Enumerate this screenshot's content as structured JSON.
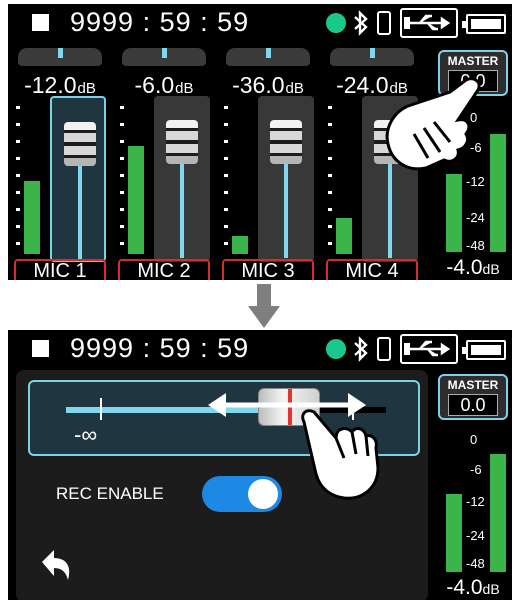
{
  "status": {
    "timecode": "9999 : 59 : 59",
    "icons": [
      "stop-icon",
      "record-status-icon",
      "bluetooth-icon",
      "phone-icon",
      "usb-icon",
      "battery-icon"
    ],
    "rec_color": "#18c98a"
  },
  "screen1": {
    "channels": [
      {
        "level": "-12.0",
        "unit": "dB",
        "label": "MIC 1",
        "meter": 0.44,
        "selected": true
      },
      {
        "level": "-6.0",
        "unit": "dB",
        "label": "MIC 2",
        "meter": 0.68,
        "selected": false
      },
      {
        "level": "-36.0",
        "unit": "dB",
        "label": "MIC 3",
        "meter": 0.11,
        "selected": false
      },
      {
        "level": "-24.0",
        "unit": "dB",
        "label": "MIC 4",
        "meter": 0.23,
        "selected": false
      }
    ],
    "master": {
      "title": "MASTER",
      "value": "0.0",
      "scale": [
        "0",
        "-6",
        "-12",
        "-24",
        "-48"
      ],
      "level": "-4.0",
      "unit": "dB",
      "meters": [
        0.45,
        0.78
      ]
    }
  },
  "screen2": {
    "slider": {
      "min_label": "-∞"
    },
    "rec_enable": {
      "label": "REC ENABLE",
      "on": true
    },
    "master": {
      "title": "MASTER",
      "value": "0.0",
      "scale": [
        "0",
        "-6",
        "-12",
        "-24",
        "-48"
      ],
      "level": "-4.0",
      "unit": "dB",
      "meters": [
        0.62,
        0.86
      ]
    }
  },
  "colors": {
    "accent": "#7cd3e8",
    "meter": "#3bb54a",
    "mic_border": "#d42b2b",
    "toggle": "#1e88e5"
  }
}
